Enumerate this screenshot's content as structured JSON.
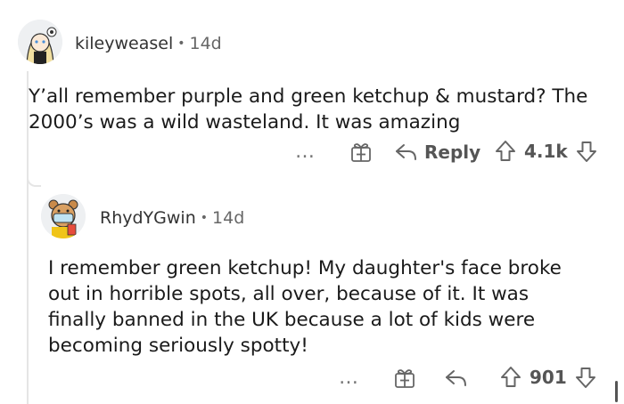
{
  "comments": [
    {
      "username": "kileyweasel",
      "separator": "•",
      "age": "14d",
      "body_line1": "Y’all remember purple and green ketchup & mustard? The",
      "body_line2": "2000’s was a wild wasteland. It was amazing",
      "actions": {
        "more": "…",
        "reply_label": "Reply",
        "score": "4.1k"
      },
      "avatar_icon": "avatar-blonde-girl-icon"
    },
    {
      "username": "RhydYGwin",
      "separator": "•",
      "age": "14d",
      "body_line1": "I remember green ketchup! My daughter's face broke",
      "body_line2": "out in horrible spots, all over, because of it. It was",
      "body_line3": "finally banned in the UK because a lot of kids were",
      "body_line4": "becoming seriously spotty!",
      "actions": {
        "more": "…",
        "score": "901"
      },
      "avatar_icon": "avatar-bear-mask-icon"
    }
  ],
  "colors": {
    "text": "#1a1a1a",
    "meta": "#666666",
    "thread_line": "#e5e5e5"
  }
}
